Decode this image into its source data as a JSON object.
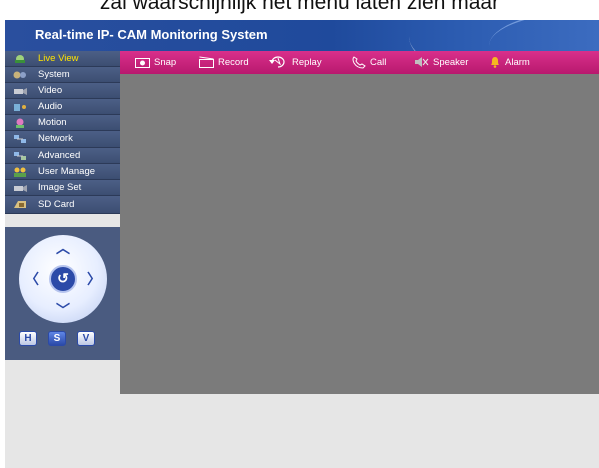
{
  "caption": "zal waarschijnlijk het menu laten zien maar",
  "app": {
    "title": "Real-time IP- CAM Monitoring System"
  },
  "menu": {
    "items": [
      {
        "label": "Live View",
        "icon": "live-view-icon",
        "active": true
      },
      {
        "label": "System",
        "icon": "system-icon"
      },
      {
        "label": "Video",
        "icon": "video-icon"
      },
      {
        "label": "Audio",
        "icon": "audio-icon"
      },
      {
        "label": "Motion",
        "icon": "motion-icon"
      },
      {
        "label": "Network",
        "icon": "network-icon"
      },
      {
        "label": "Advanced",
        "icon": "advanced-icon"
      },
      {
        "label": "User Manage",
        "icon": "user-manage-icon"
      },
      {
        "label": "Image Set",
        "icon": "image-set-icon"
      },
      {
        "label": "SD Card",
        "icon": "sd-card-icon"
      }
    ]
  },
  "ptz": {
    "buttons": [
      "H",
      "S",
      "V"
    ],
    "selected": "S"
  },
  "toolbar": {
    "items": [
      {
        "label": "Snap",
        "icon": "camera-icon"
      },
      {
        "label": "Record",
        "icon": "clapperboard-icon"
      },
      {
        "label": "Replay",
        "icon": "replay-icon"
      },
      {
        "label": "Call",
        "icon": "phone-icon"
      },
      {
        "label": "Speaker",
        "icon": "speaker-muted-icon"
      },
      {
        "label": "Alarm",
        "icon": "bell-icon"
      }
    ]
  },
  "colors": {
    "banner": "#1f4a9c",
    "toolbar": "#c41f7c",
    "menu": "#44577c",
    "active_menu_text": "#ffe400",
    "video_background": "#7b7b7b"
  }
}
